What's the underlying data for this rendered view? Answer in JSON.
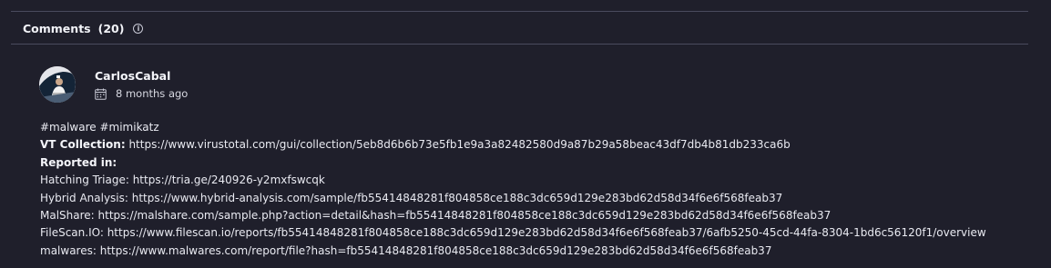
{
  "header": {
    "title": "Comments",
    "count": "(20)",
    "info_icon": "info-icon"
  },
  "comment": {
    "author": "CarlosCabal",
    "timestamp": "8 months ago",
    "icons": {
      "avatar": "avatar",
      "calendar": "calendar-icon"
    },
    "tags": "#malware #mimikatz",
    "vt_collection": {
      "label": "VT Collection:",
      "value": " https://www.virustotal.com/gui/collection/5eb8d6b6b73e5fb1e9a3a82482580d9a87b29a58beac43df7db4b81db233ca6b"
    },
    "reported_in_label": "Reported in:",
    "reports": [
      "Hatching Triage: https://tria.ge/240926-y2mxfswcqk",
      "Hybrid Analysis: https://www.hybrid-analysis.com/sample/fb55414848281f804858ce188c3dc659d129e283bd62d58d34f6e6f568feab37",
      "MalShare: https://malshare.com/sample.php?action=detail&hash=fb55414848281f804858ce188c3dc659d129e283bd62d58d34f6e6f568feab37",
      "FileScan.IO: https://www.filescan.io/reports/fb55414848281f804858ce188c3dc659d129e283bd62d58d34f6e6f568feab37/6afb5250-45cd-44fa-8304-1bd6c56120f1/overview",
      "malwares: https://www.malwares.com/report/file?hash=fb55414848281f804858ce188c3dc659d129e283bd62d58d34f6e6f568feab37"
    ]
  },
  "colors": {
    "background": "#1f1f2b",
    "divider": "#4a4b5e",
    "text": "#e9eaf1"
  }
}
